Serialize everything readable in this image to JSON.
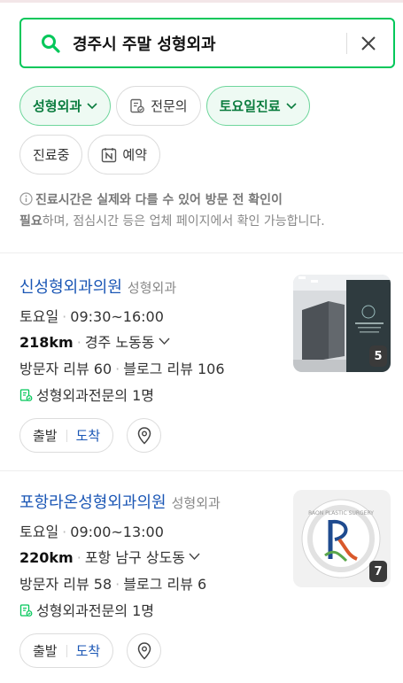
{
  "search": {
    "query": "경주시  주말 성형외과"
  },
  "filters": {
    "row1": [
      {
        "label": "성형외과",
        "active": true,
        "dropdown": true,
        "icon": ""
      },
      {
        "label": "전문의",
        "active": false,
        "dropdown": false,
        "icon": "certificate-icon"
      },
      {
        "label": "토요일진료",
        "active": true,
        "dropdown": true,
        "icon": ""
      }
    ],
    "row2": [
      {
        "label": "진료중",
        "active": false,
        "icon": ""
      },
      {
        "label": "예약",
        "active": false,
        "icon": "naver-booking-icon"
      }
    ]
  },
  "notice": {
    "bold1": "진료시간은 실제와 다를 수 있어 방문 전 확인이",
    "bold2": "필요",
    "rest": "하며, 점심시간 등은 업체 페이지에서 확인 가능합니다."
  },
  "results": [
    {
      "name": "신성형외과의원",
      "category": "성형외과",
      "day": "토요일",
      "hours": "09:30~16:00",
      "distance": "218km",
      "area": "경주 노동동",
      "visitor_reviews": "방문자 리뷰 60",
      "blog_reviews": "블로그 리뷰 106",
      "specialist": "성형외과전문의 1명",
      "depart_label": "출발",
      "arrive_label": "도착",
      "photo_count": "5"
    },
    {
      "name": "포항라온성형외과의원",
      "category": "성형외과",
      "day": "토요일",
      "hours": "09:00~13:00",
      "distance": "220km",
      "area": "포항 남구 상도동",
      "visitor_reviews": "방문자 리뷰 58",
      "blog_reviews": "블로그 리뷰 6",
      "specialist": "성형외과전문의 1명",
      "depart_label": "출발",
      "arrive_label": "도착",
      "photo_count": "7",
      "logo_text": "RAON PLASTIC SURGERY"
    }
  ],
  "colors": {
    "accent": "#03c75a",
    "link": "#1a56b5"
  }
}
